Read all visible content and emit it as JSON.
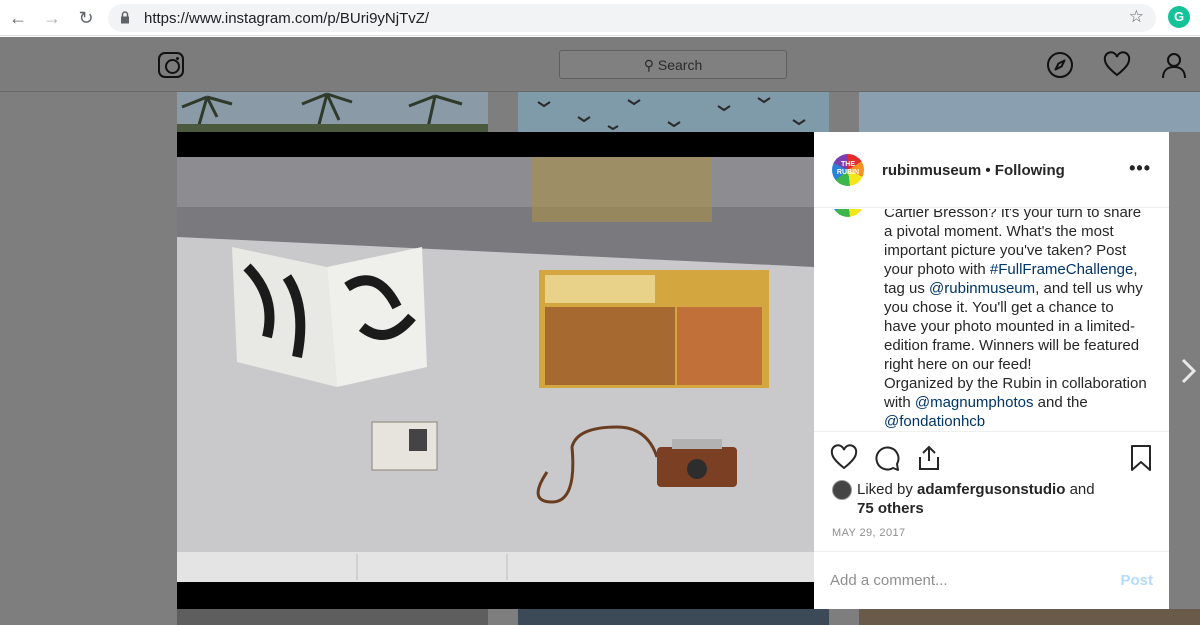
{
  "browser": {
    "url": "https://www.instagram.com/p/BUri9yNjTvZ/",
    "extension_letter": "G"
  },
  "instagram": {
    "search_placeholder": "Search"
  },
  "post": {
    "username": "rubinmuseum",
    "follow_status": "Following",
    "header_separator": "•",
    "avatar_text": "THE RUBIN",
    "caption_lines": [
      {
        "parts": [
          {
            "text": "Cartier Bresson? It's your turn to share",
            "link": false
          }
        ]
      },
      {
        "parts": [
          {
            "text": "a pivotal moment. What's the most",
            "link": false
          }
        ]
      },
      {
        "parts": [
          {
            "text": "important picture you've taken? Post",
            "link": false
          }
        ]
      },
      {
        "parts": [
          {
            "text": "your photo with ",
            "link": false
          },
          {
            "text": "#FullFrameChallenge",
            "link": true
          },
          {
            "text": ",",
            "link": false
          }
        ]
      },
      {
        "parts": [
          {
            "text": "tag us ",
            "link": false
          },
          {
            "text": "@rubinmuseum",
            "link": true
          },
          {
            "text": ", and tell us why",
            "link": false
          }
        ]
      },
      {
        "parts": [
          {
            "text": "you chose it. You'll get a chance to",
            "link": false
          }
        ]
      },
      {
        "parts": [
          {
            "text": "have your photo mounted in a limited-",
            "link": false
          }
        ]
      },
      {
        "parts": [
          {
            "text": "edition frame. Winners will be featured",
            "link": false
          }
        ]
      },
      {
        "parts": [
          {
            "text": "right here on our feed!",
            "link": false
          }
        ]
      },
      {
        "parts": [
          {
            "text": "Organized by the Rubin in collaboration",
            "link": false
          }
        ]
      },
      {
        "parts": [
          {
            "text": "with ",
            "link": false
          },
          {
            "text": "@magnumphotos",
            "link": true
          },
          {
            "text": " and the",
            "link": false
          }
        ]
      },
      {
        "parts": [
          {
            "text": "@fondationhcb",
            "link": true
          }
        ]
      }
    ],
    "likes_prefix": "Liked by ",
    "liked_by_user": "adamfergusonstudio",
    "likes_connector": " and",
    "likes_others": "75 others",
    "date": "MAY 29, 2017",
    "comment_placeholder": "Add a comment...",
    "post_button": "Post"
  },
  "colors": {
    "link": "#003569",
    "post_button_disabled": "#b3dbff",
    "overlay": "#7e7e7e"
  }
}
